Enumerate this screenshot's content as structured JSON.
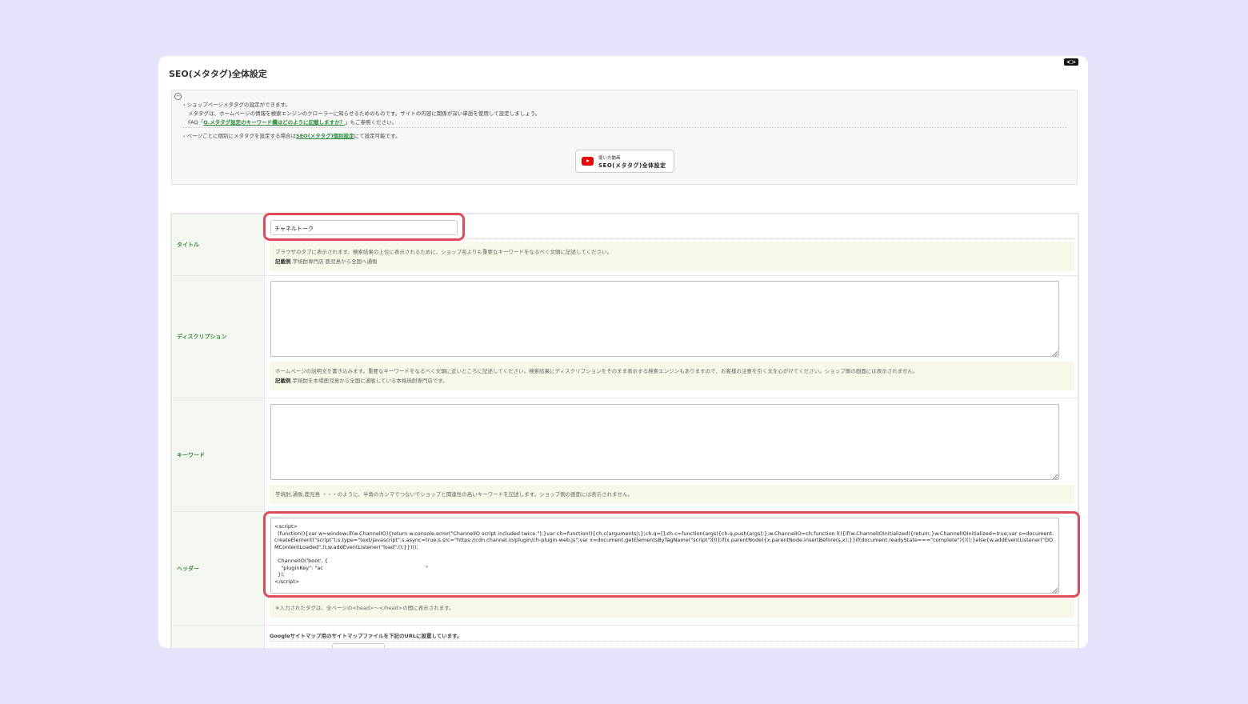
{
  "page": {
    "title": "SEO(メタタグ)全体設定"
  },
  "info": {
    "line1": "ショップページメタタグの設定ができます。",
    "line2": "メタタグは、ホームページの情報を検索エンジンのクローラーに知らせるためのものです。サイトの内容に関係が深い単語を使用して設定しましょう。",
    "faq_prefix": "FAQ「",
    "faq_link": "Q.メタタグ設定のキーワード欄はどのように記載しますか？",
    "faq_suffix": "」もご参照ください。",
    "line4_prefix": "ページごとに個別にメタタグを設定する場合は",
    "line4_link": "SEO(メタタグ)個別設定",
    "line4_suffix": "にて設定可能です。",
    "video_small": "使い方動画",
    "video_main": "SEO(メタタグ)全体設定"
  },
  "form": {
    "title": {
      "label": "タイトル",
      "value": "チャネルトーク",
      "note": "ブラウザのタブに表示されます。検索結果の上位に表示されるために、ショップ名よりも重要なキーワードをなるべく文頭に記述してください。",
      "example_label": "記載例",
      "example": "芋焼酎専門店 鹿児島から全国へ通販"
    },
    "description": {
      "label": "ディスクリプション",
      "value": "",
      "note": "ホームページの説明文を書き込みます。重要なキーワードをなるべく文頭に近いところに記述してください。検索結果にディスクリプションをそのまま表示する検索エンジンもありますので、お客様の注意を引く文を心がけてください。ショップ側の画面には表示されません。",
      "example_label": "記載例",
      "example": "芋焼酎を本場鹿児島から全国に通販している本格焼酎専門店です。"
    },
    "keywords": {
      "label": "キーワード",
      "value": "",
      "note": "芋焼酎,通販,鹿児島 ・・・のように、半角のカンマでつないでショップと関連性の高いキーワードを記述します。ショップ側の画面には表示されません。"
    },
    "header": {
      "label": "ヘッダー",
      "value": "<script>\n  (function(){var w=window;if(w.ChannelIO){return w.console.error(\"ChannelIO script included twice.\");}var ch=function(){ch.c(arguments);};ch.q=[];ch.c=function(args){ch.q.push(args);};w.ChannelIO=ch;function l(){if(w.ChannelIOInitialized){return;}w.ChannelIOInitialized=true;var s=document.createElement(\"script\");s.type=\"text/javascript\";s.async=true;s.src=\"https://cdn.channel.io/plugin/ch-plugin-web.js\";var x=document.getElementsByTagName(\"script\")[0];if(x.parentNode){x.parentNode.insertBefore(s,x);}}if(document.readyState===\"complete\"){l();}else{w.addEventListener(\"DOMContentLoaded\",l);w.addEventListener(\"load\",l);}})();\n\n  ChannelIO('boot', {\n    \"pluginKey\": \"ac                                                              \"\n  });\n</script>",
      "note": "※入力されたタグは、全ページの<head>〜</head>の間に表示されます。"
    },
    "sitemap": {
      "note": "Googleサイトマップ用のサイトマップファイルを下記のURLに設置しています。"
    }
  },
  "colors": {
    "background": "#e4e3fd",
    "highlight": "#e04a5a",
    "label_text": "#3a8a3a",
    "link": "#2e8b3c"
  }
}
